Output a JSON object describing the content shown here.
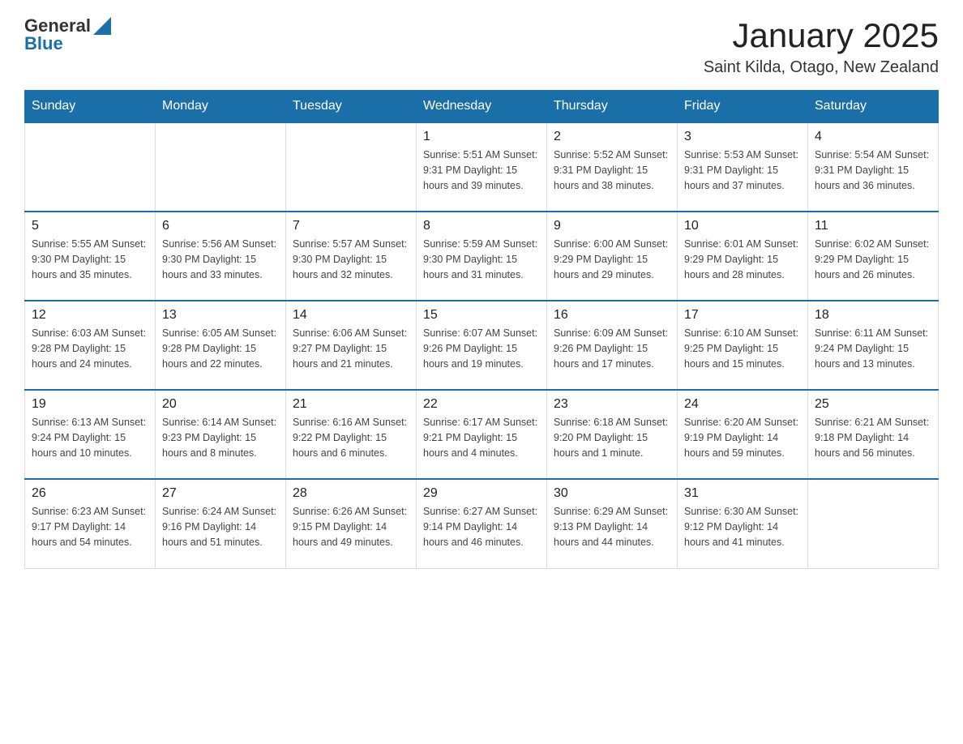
{
  "header": {
    "logo": {
      "general": "General",
      "blue": "Blue"
    },
    "title": "January 2025",
    "subtitle": "Saint Kilda, Otago, New Zealand"
  },
  "days_of_week": [
    "Sunday",
    "Monday",
    "Tuesday",
    "Wednesday",
    "Thursday",
    "Friday",
    "Saturday"
  ],
  "weeks": [
    [
      {
        "day": "",
        "info": ""
      },
      {
        "day": "",
        "info": ""
      },
      {
        "day": "",
        "info": ""
      },
      {
        "day": "1",
        "info": "Sunrise: 5:51 AM\nSunset: 9:31 PM\nDaylight: 15 hours and 39 minutes."
      },
      {
        "day": "2",
        "info": "Sunrise: 5:52 AM\nSunset: 9:31 PM\nDaylight: 15 hours and 38 minutes."
      },
      {
        "day": "3",
        "info": "Sunrise: 5:53 AM\nSunset: 9:31 PM\nDaylight: 15 hours and 37 minutes."
      },
      {
        "day": "4",
        "info": "Sunrise: 5:54 AM\nSunset: 9:31 PM\nDaylight: 15 hours and 36 minutes."
      }
    ],
    [
      {
        "day": "5",
        "info": "Sunrise: 5:55 AM\nSunset: 9:30 PM\nDaylight: 15 hours and 35 minutes."
      },
      {
        "day": "6",
        "info": "Sunrise: 5:56 AM\nSunset: 9:30 PM\nDaylight: 15 hours and 33 minutes."
      },
      {
        "day": "7",
        "info": "Sunrise: 5:57 AM\nSunset: 9:30 PM\nDaylight: 15 hours and 32 minutes."
      },
      {
        "day": "8",
        "info": "Sunrise: 5:59 AM\nSunset: 9:30 PM\nDaylight: 15 hours and 31 minutes."
      },
      {
        "day": "9",
        "info": "Sunrise: 6:00 AM\nSunset: 9:29 PM\nDaylight: 15 hours and 29 minutes."
      },
      {
        "day": "10",
        "info": "Sunrise: 6:01 AM\nSunset: 9:29 PM\nDaylight: 15 hours and 28 minutes."
      },
      {
        "day": "11",
        "info": "Sunrise: 6:02 AM\nSunset: 9:29 PM\nDaylight: 15 hours and 26 minutes."
      }
    ],
    [
      {
        "day": "12",
        "info": "Sunrise: 6:03 AM\nSunset: 9:28 PM\nDaylight: 15 hours and 24 minutes."
      },
      {
        "day": "13",
        "info": "Sunrise: 6:05 AM\nSunset: 9:28 PM\nDaylight: 15 hours and 22 minutes."
      },
      {
        "day": "14",
        "info": "Sunrise: 6:06 AM\nSunset: 9:27 PM\nDaylight: 15 hours and 21 minutes."
      },
      {
        "day": "15",
        "info": "Sunrise: 6:07 AM\nSunset: 9:26 PM\nDaylight: 15 hours and 19 minutes."
      },
      {
        "day": "16",
        "info": "Sunrise: 6:09 AM\nSunset: 9:26 PM\nDaylight: 15 hours and 17 minutes."
      },
      {
        "day": "17",
        "info": "Sunrise: 6:10 AM\nSunset: 9:25 PM\nDaylight: 15 hours and 15 minutes."
      },
      {
        "day": "18",
        "info": "Sunrise: 6:11 AM\nSunset: 9:24 PM\nDaylight: 15 hours and 13 minutes."
      }
    ],
    [
      {
        "day": "19",
        "info": "Sunrise: 6:13 AM\nSunset: 9:24 PM\nDaylight: 15 hours and 10 minutes."
      },
      {
        "day": "20",
        "info": "Sunrise: 6:14 AM\nSunset: 9:23 PM\nDaylight: 15 hours and 8 minutes."
      },
      {
        "day": "21",
        "info": "Sunrise: 6:16 AM\nSunset: 9:22 PM\nDaylight: 15 hours and 6 minutes."
      },
      {
        "day": "22",
        "info": "Sunrise: 6:17 AM\nSunset: 9:21 PM\nDaylight: 15 hours and 4 minutes."
      },
      {
        "day": "23",
        "info": "Sunrise: 6:18 AM\nSunset: 9:20 PM\nDaylight: 15 hours and 1 minute."
      },
      {
        "day": "24",
        "info": "Sunrise: 6:20 AM\nSunset: 9:19 PM\nDaylight: 14 hours and 59 minutes."
      },
      {
        "day": "25",
        "info": "Sunrise: 6:21 AM\nSunset: 9:18 PM\nDaylight: 14 hours and 56 minutes."
      }
    ],
    [
      {
        "day": "26",
        "info": "Sunrise: 6:23 AM\nSunset: 9:17 PM\nDaylight: 14 hours and 54 minutes."
      },
      {
        "day": "27",
        "info": "Sunrise: 6:24 AM\nSunset: 9:16 PM\nDaylight: 14 hours and 51 minutes."
      },
      {
        "day": "28",
        "info": "Sunrise: 6:26 AM\nSunset: 9:15 PM\nDaylight: 14 hours and 49 minutes."
      },
      {
        "day": "29",
        "info": "Sunrise: 6:27 AM\nSunset: 9:14 PM\nDaylight: 14 hours and 46 minutes."
      },
      {
        "day": "30",
        "info": "Sunrise: 6:29 AM\nSunset: 9:13 PM\nDaylight: 14 hours and 44 minutes."
      },
      {
        "day": "31",
        "info": "Sunrise: 6:30 AM\nSunset: 9:12 PM\nDaylight: 14 hours and 41 minutes."
      },
      {
        "day": "",
        "info": ""
      }
    ]
  ]
}
